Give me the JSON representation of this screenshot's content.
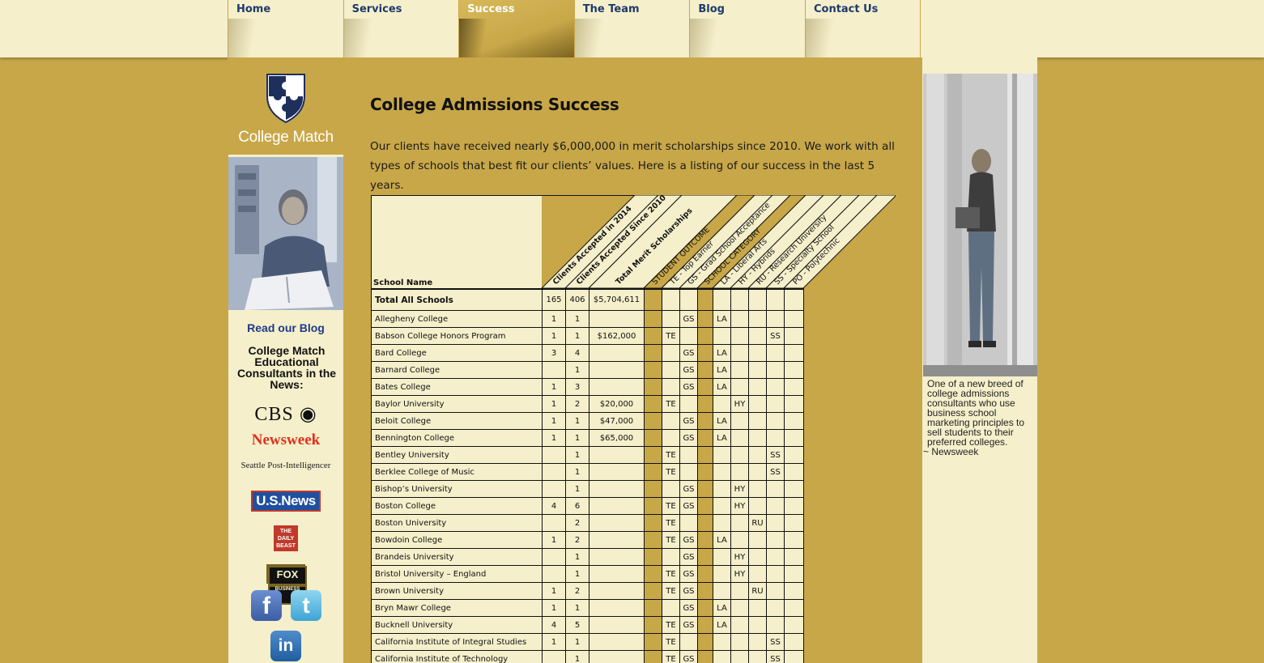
{
  "nav": {
    "items": [
      {
        "label": "Home",
        "active": false
      },
      {
        "label": "Services",
        "active": false
      },
      {
        "label": "Success",
        "active": true
      },
      {
        "label": "The Team",
        "active": false
      },
      {
        "label": "Blog",
        "active": false
      },
      {
        "label": "Contact Us",
        "active": false
      }
    ]
  },
  "sidebar": {
    "logo_text": "College Match",
    "blog_link": "Read our Blog",
    "news_heading": "College Match Educational Consultants in the News:",
    "media": {
      "cbs": "CBS",
      "newsweek": "Newsweek",
      "spi": "Seattle Post-Intelligencer",
      "usnews": "U.S.News",
      "dailybeast": "THE DAILY BEAST",
      "fox": "FOX",
      "fox_sub": "BUSINESS"
    },
    "social": {
      "facebook": "f",
      "twitter": "t",
      "linkedin": "in"
    }
  },
  "main": {
    "title": "College Admissions Success",
    "intro": "Our clients have received nearly $6,000,000 in merit scholarships since 2010. We work with all types of schools that best fit our clients’ values. Here is a listing of our success in the last 5 years."
  },
  "table": {
    "school_name_header": "School Name",
    "column_headers": [
      "Clients Accepted in 2014",
      "Clients Accepted Since 2010",
      "Total Merit Scholarships",
      "STUDENT OUTCOME",
      "TE - Top Earner",
      "GS - Grad School Acceptance",
      "SCHOOL CATEGORY",
      "LA - Liberal Arts",
      "HY - Hybrids",
      "RU - Research University",
      "SS - Specialty School",
      "PO - Polytechnic"
    ],
    "total": {
      "name": "Total All Schools",
      "y2014": "165",
      "since2010": "406",
      "merit": "$5,704,611"
    },
    "rows": [
      {
        "name": "Allegheny College",
        "y2014": "1",
        "since2010": "1",
        "merit": "",
        "te": "",
        "gs": "GS",
        "la": "LA",
        "hy": "",
        "ru": "",
        "ss": "",
        "po": ""
      },
      {
        "name": "Babson College Honors Program",
        "y2014": "1",
        "since2010": "1",
        "merit": "$162,000",
        "te": "TE",
        "gs": "",
        "la": "",
        "hy": "",
        "ru": "",
        "ss": "SS",
        "po": ""
      },
      {
        "name": "Bard College",
        "y2014": "3",
        "since2010": "4",
        "merit": "",
        "te": "",
        "gs": "GS",
        "la": "LA",
        "hy": "",
        "ru": "",
        "ss": "",
        "po": ""
      },
      {
        "name": "Barnard College",
        "y2014": "",
        "since2010": "1",
        "merit": "",
        "te": "",
        "gs": "GS",
        "la": "LA",
        "hy": "",
        "ru": "",
        "ss": "",
        "po": ""
      },
      {
        "name": "Bates College",
        "y2014": "1",
        "since2010": "3",
        "merit": "",
        "te": "",
        "gs": "GS",
        "la": "LA",
        "hy": "",
        "ru": "",
        "ss": "",
        "po": ""
      },
      {
        "name": "Baylor University",
        "y2014": "1",
        "since2010": "2",
        "merit": "$20,000",
        "te": "TE",
        "gs": "",
        "la": "",
        "hy": "HY",
        "ru": "",
        "ss": "",
        "po": ""
      },
      {
        "name": "Beloit College",
        "y2014": "1",
        "since2010": "1",
        "merit": "$47,000",
        "te": "",
        "gs": "GS",
        "la": "LA",
        "hy": "",
        "ru": "",
        "ss": "",
        "po": ""
      },
      {
        "name": "Bennington College",
        "y2014": "1",
        "since2010": "1",
        "merit": "$65,000",
        "te": "",
        "gs": "GS",
        "la": "LA",
        "hy": "",
        "ru": "",
        "ss": "",
        "po": ""
      },
      {
        "name": "Bentley University",
        "y2014": "",
        "since2010": "1",
        "merit": "",
        "te": "TE",
        "gs": "",
        "la": "",
        "hy": "",
        "ru": "",
        "ss": "SS",
        "po": ""
      },
      {
        "name": "Berklee College of Music",
        "y2014": "",
        "since2010": "1",
        "merit": "",
        "te": "TE",
        "gs": "",
        "la": "",
        "hy": "",
        "ru": "",
        "ss": "SS",
        "po": ""
      },
      {
        "name": "Bishop’s University",
        "y2014": "",
        "since2010": "1",
        "merit": "",
        "te": "",
        "gs": "GS",
        "la": "",
        "hy": "HY",
        "ru": "",
        "ss": "",
        "po": ""
      },
      {
        "name": "Boston College",
        "y2014": "4",
        "since2010": "6",
        "merit": "",
        "te": "TE",
        "gs": "GS",
        "la": "",
        "hy": "HY",
        "ru": "",
        "ss": "",
        "po": ""
      },
      {
        "name": "Boston University",
        "y2014": "",
        "since2010": "2",
        "merit": "",
        "te": "TE",
        "gs": "",
        "la": "",
        "hy": "",
        "ru": "RU",
        "ss": "",
        "po": ""
      },
      {
        "name": "Bowdoin College",
        "y2014": "1",
        "since2010": "2",
        "merit": "",
        "te": "TE",
        "gs": "GS",
        "la": "LA",
        "hy": "",
        "ru": "",
        "ss": "",
        "po": ""
      },
      {
        "name": "Brandeis University",
        "y2014": "",
        "since2010": "1",
        "merit": "",
        "te": "",
        "gs": "GS",
        "la": "",
        "hy": "HY",
        "ru": "",
        "ss": "",
        "po": ""
      },
      {
        "name": "Bristol University – England",
        "y2014": "",
        "since2010": "1",
        "merit": "",
        "te": "TE",
        "gs": "GS",
        "la": "",
        "hy": "HY",
        "ru": "",
        "ss": "",
        "po": ""
      },
      {
        "name": "Brown University",
        "y2014": "1",
        "since2010": "2",
        "merit": "",
        "te": "TE",
        "gs": "GS",
        "la": "",
        "hy": "",
        "ru": "RU",
        "ss": "",
        "po": ""
      },
      {
        "name": "Bryn Mawr College",
        "y2014": "1",
        "since2010": "1",
        "merit": "",
        "te": "",
        "gs": "GS",
        "la": "LA",
        "hy": "",
        "ru": "",
        "ss": "",
        "po": ""
      },
      {
        "name": "Bucknell University",
        "y2014": "4",
        "since2010": "5",
        "merit": "",
        "te": "TE",
        "gs": "GS",
        "la": "LA",
        "hy": "",
        "ru": "",
        "ss": "",
        "po": ""
      },
      {
        "name": "California Institute of Integral Studies",
        "y2014": "1",
        "since2010": "1",
        "merit": "",
        "te": "TE",
        "gs": "",
        "la": "",
        "hy": "",
        "ru": "",
        "ss": "SS",
        "po": ""
      },
      {
        "name": "California Institute of Technology",
        "y2014": "",
        "since2010": "1",
        "merit": "",
        "te": "TE",
        "gs": "GS",
        "la": "",
        "hy": "",
        "ru": "",
        "ss": "SS",
        "po": ""
      }
    ]
  },
  "right": {
    "quote": "One of a new breed of college admissions consultants who use business school marketing principles to sell students to their preferred colleges.",
    "source": "~ Newsweek"
  }
}
